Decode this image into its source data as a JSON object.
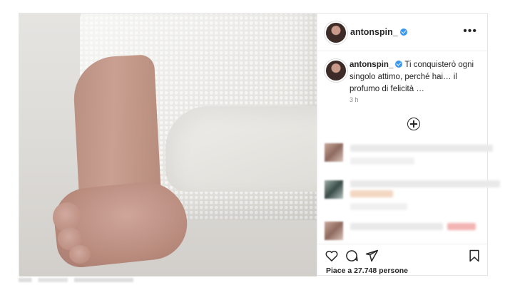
{
  "post": {
    "username": "antonspin_",
    "caption": "Ti conquisterò ogni singolo attimo, perché hai… il profumo di felicità …",
    "time": "3 h",
    "more_icon": "more-dots-icon",
    "add_comment_icon": "plus-circle-icon",
    "likes_text": "Piace a 27.748 persone",
    "actions": {
      "like": "heart-icon",
      "comment": "comment-icon",
      "share": "send-icon",
      "save": "bookmark-icon"
    }
  },
  "colors": {
    "verified": "#3897f0",
    "text": "#262626",
    "muted": "#8e8e8e",
    "divider": "#efefef"
  }
}
